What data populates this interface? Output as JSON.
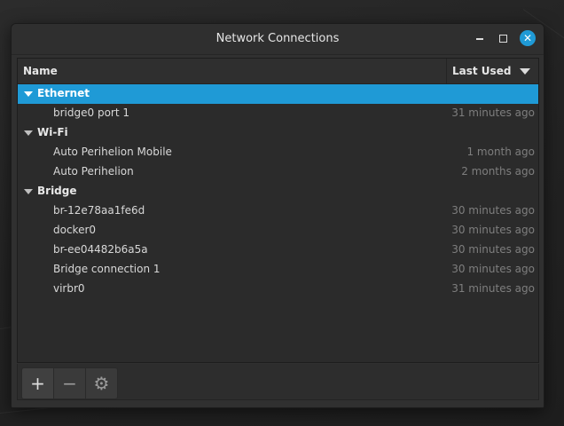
{
  "window": {
    "title": "Network Connections"
  },
  "header": {
    "name_label": "Name",
    "last_used_label": "Last Used"
  },
  "groups": [
    {
      "label": "Ethernet",
      "selected": true,
      "items": [
        {
          "name": "bridge0 port 1",
          "last_used": "31 minutes ago"
        }
      ]
    },
    {
      "label": "Wi-Fi",
      "selected": false,
      "items": [
        {
          "name": "Auto Perihelion Mobile",
          "last_used": "1 month ago"
        },
        {
          "name": "Auto Perihelion",
          "last_used": "2 months ago"
        }
      ]
    },
    {
      "label": "Bridge",
      "selected": false,
      "items": [
        {
          "name": "br-12e78aa1fe6d",
          "last_used": "30 minutes ago"
        },
        {
          "name": "docker0",
          "last_used": "30 minutes ago"
        },
        {
          "name": "br-ee04482b6a5a",
          "last_used": "30 minutes ago"
        },
        {
          "name": "Bridge connection 1",
          "last_used": "30 minutes ago"
        },
        {
          "name": "virbr0",
          "last_used": "31 minutes ago"
        }
      ]
    }
  ],
  "toolbar": {
    "add_icon": "plus-icon",
    "remove_icon": "minus-icon",
    "settings_icon": "gear-icon",
    "add_glyph": "+",
    "remove_glyph": "−",
    "settings_glyph": "⚙"
  },
  "colors": {
    "accent": "#1f9ad6",
    "background": "#303030",
    "muted_text": "#7e7e7e"
  }
}
